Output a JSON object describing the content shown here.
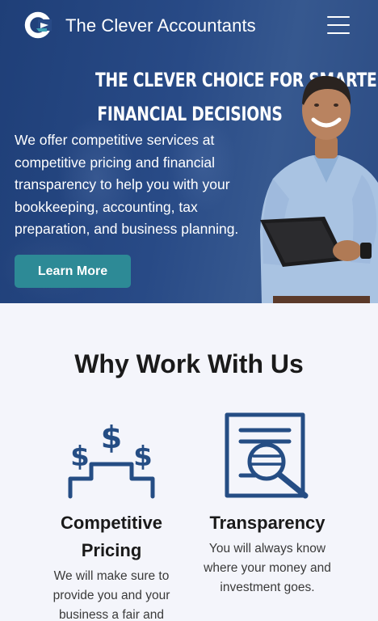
{
  "header": {
    "brand_name": "The Clever Accountants",
    "logo_icon": "c-logo-icon",
    "menu_icon": "hamburger-menu-icon"
  },
  "hero": {
    "headline_line1": "THE CLEVER CHOICE FOR SMARTER",
    "headline_line2": "FINANCIAL DECISIONS",
    "body": "We offer competitive services at competitive pricing and financial transparency to help you with your bookkeeping, accounting, tax preparation, and business planning.",
    "cta_label": "Learn More"
  },
  "why": {
    "title": "Why Work With Us",
    "features": [
      {
        "icon": "dollar-podium-icon",
        "title": "Competitive Pricing",
        "text": "We will make sure to provide you and your business a fair and"
      },
      {
        "icon": "document-magnifier-icon",
        "title": "Transparency",
        "text": "You will always know where your money and investment goes."
      }
    ]
  },
  "colors": {
    "hero_bg": "#284a86",
    "button_bg": "#2d8a96",
    "icon_blue": "#254d84",
    "page_bg": "#f4f5fb"
  }
}
